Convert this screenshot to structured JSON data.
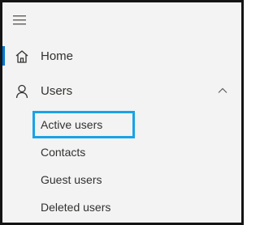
{
  "nav": {
    "home": {
      "label": "Home",
      "icon": "home-icon",
      "active": true
    },
    "users": {
      "label": "Users",
      "icon": "person-icon",
      "expanded": true,
      "chevron_icon": "chevron-up-icon",
      "subitems": [
        {
          "label": "Active users",
          "highlighted": true
        },
        {
          "label": "Contacts"
        },
        {
          "label": "Guest users"
        },
        {
          "label": "Deleted users"
        }
      ]
    }
  },
  "colors": {
    "accent": "#0078d4",
    "highlight_border": "#19a3e6",
    "panel_background": "#f3f3f3",
    "frame_border": "#141414",
    "text": "#323130"
  }
}
